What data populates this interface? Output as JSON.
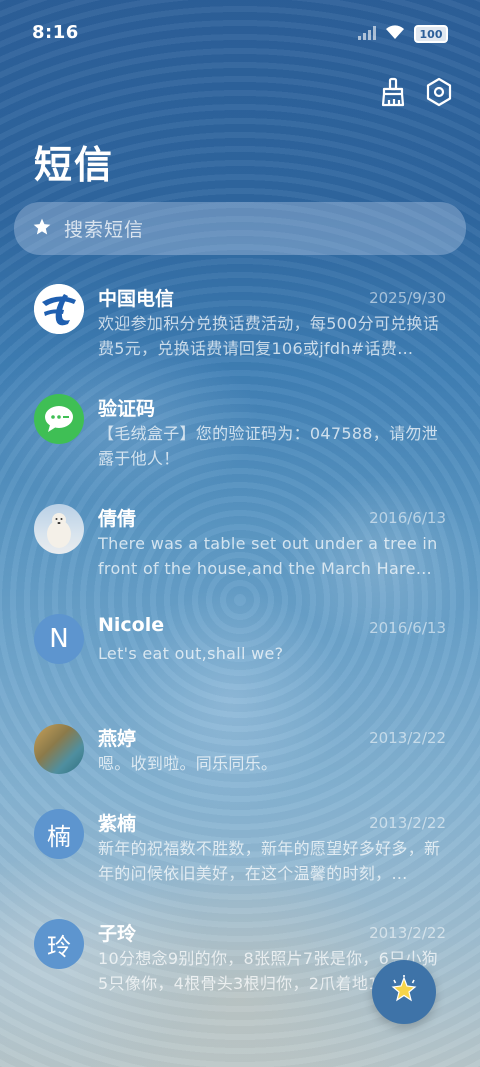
{
  "status_bar": {
    "time": "8:16",
    "battery": "100"
  },
  "header": {
    "title": "短信"
  },
  "search": {
    "placeholder": "搜索短信"
  },
  "conversations": [
    {
      "name": "中国电信",
      "date": "2025/9/30",
      "preview": "欢迎参加积分兑换话费活动，每500分可兑换话费5元，兑换话费请回复106或jfdh#话费…",
      "avatar": "china-telecom-logo-icon"
    },
    {
      "name": "验证码",
      "date": "",
      "preview": "【毛绒盒子】您的验证码为：047588，请勿泄露于他人！",
      "avatar": "message-bubble-icon"
    },
    {
      "name": "倩倩",
      "date": "2016/6/13",
      "preview": "There was a table set out under a tree in front of the house,and the March Hare an…",
      "avatar": "polar-bear-photo"
    },
    {
      "name": "Nicole",
      "date": "2016/6/13",
      "preview": "Let's eat out,shall we?",
      "avatar_letter": "N"
    },
    {
      "name": "燕婷",
      "date": "2013/2/22",
      "preview": "嗯。收到啦。同乐同乐。",
      "avatar": "landscape-photo"
    },
    {
      "name": "紫楠",
      "date": "2013/2/22",
      "preview": "新年的祝福数不胜数，新年的愿望好多好多，新年的问候依旧美好，在这个温馨的时刻，…",
      "avatar_letter": "楠"
    },
    {
      "name": "子玲",
      "date": "2013/2/22",
      "preview": "10分想念9别的你，8张照片7张是你，6只小狗5只像你，4根骨头3根归你，2爪着地1定…",
      "avatar_letter": "玲"
    }
  ],
  "colors": {
    "avatar_letter_bg": "#5d95cf",
    "fab_bg": "#3e73a8",
    "green_avatar": "#3fbf55"
  }
}
